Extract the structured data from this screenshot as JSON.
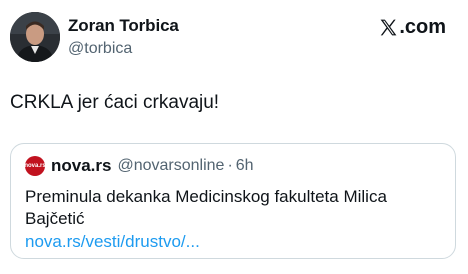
{
  "author": {
    "name": "Zoran Torbica",
    "handle": "@torbica",
    "avatar_icon": "person-avatar"
  },
  "brand": {
    "suffix": ".com",
    "icon": "x-logo-icon"
  },
  "tweet": {
    "text": "CRKLA jer ćaci crkavaju!"
  },
  "quoted": {
    "logo_text": "nova.rs",
    "name": "nova.rs",
    "handle": "@novarsonline",
    "separator": "·",
    "time": "6h",
    "text": "Preminula dekanka Medicinskog fakulteta Milica Bajčetić",
    "link": "nova.rs/vesti/drustvo/..."
  },
  "colors": {
    "text": "#0f1419",
    "secondary": "#536471",
    "link": "#1d9bf0",
    "border": "#cfd9de",
    "nova_red": "#c1121f"
  }
}
